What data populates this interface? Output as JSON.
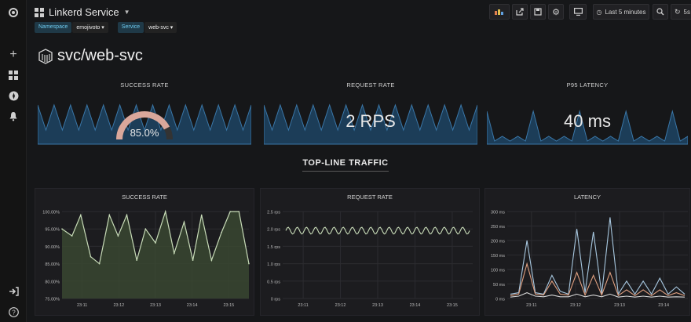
{
  "header": {
    "title": "Linkerd Service",
    "time_range": "Last 5 minutes",
    "refresh": "5s"
  },
  "variables": [
    {
      "label": "Namespace",
      "value": "emojivoto"
    },
    {
      "label": "Service",
      "value": "web-svc"
    }
  ],
  "service_title": "svc/web-svc",
  "singlestats": [
    {
      "title": "SUCCESS RATE",
      "value": "85.0%",
      "gauge_fraction": 0.85
    },
    {
      "title": "REQUEST RATE",
      "value": "2 RPS"
    },
    {
      "title": "P95 LATENCY",
      "value": "40 ms"
    }
  ],
  "row_title": "TOP-LINE TRAFFIC",
  "colors": {
    "accent_blue": "#1f4b6e",
    "spark_line": "#3a77a8",
    "gauge": "#d9a79b",
    "line_green": "#c8dcb8",
    "fill_green": "#3b4a32"
  },
  "chart_data": [
    {
      "type": "line",
      "title": "SUCCESS RATE",
      "x_ticks": [
        "23:11",
        "23:12",
        "23:13",
        "23:14",
        "23:15"
      ],
      "y_ticks": [
        "75.00%",
        "80.00%",
        "85.00%",
        "90.00%",
        "95.00%",
        "100.00%"
      ],
      "ylim": [
        75,
        100
      ],
      "xlim": [
        23.1,
        23.25
      ],
      "x": [
        23.1,
        23.108,
        23.115,
        23.123,
        23.13,
        23.138,
        23.145,
        23.152,
        23.16,
        23.167,
        23.175,
        23.183,
        23.19,
        23.198,
        23.205,
        23.212,
        23.22,
        23.228,
        23.235,
        23.242,
        23.25
      ],
      "y": [
        95,
        93,
        99,
        87,
        85,
        99,
        93,
        99,
        86,
        95,
        91,
        100,
        88,
        97,
        86,
        99,
        86,
        94,
        100,
        100,
        85
      ],
      "fill": true
    },
    {
      "type": "line",
      "title": "REQUEST RATE",
      "x_ticks": [
        "23:11",
        "23:12",
        "23:13",
        "23:14",
        "23:15"
      ],
      "y_ticks": [
        "0 rps",
        "0.5 rps",
        "1.0 rps",
        "1.5 rps",
        "2.0 rps",
        "2.5 rps"
      ],
      "ylim": [
        0,
        2.5
      ],
      "value_range": [
        1.85,
        2.05
      ]
    },
    {
      "type": "line",
      "title": "LATENCY",
      "x_ticks": [
        "23:11",
        "23:12",
        "23:13",
        "23:14"
      ],
      "y_ticks": [
        "0 ms",
        "50 ms",
        "100 ms",
        "150 ms",
        "200 ms",
        "250 ms",
        "300 ms"
      ],
      "ylim": [
        0,
        300
      ],
      "series": [
        {
          "values": [
            15,
            20,
            200,
            20,
            15,
            80,
            25,
            15,
            240,
            20,
            230,
            15,
            280,
            15,
            60,
            15,
            60,
            15,
            70,
            15,
            40,
            15
          ],
          "color": "#a8c8e0"
        },
        {
          "values": [
            10,
            15,
            120,
            15,
            12,
            60,
            15,
            12,
            90,
            12,
            80,
            12,
            90,
            10,
            30,
            10,
            30,
            10,
            30,
            10,
            20,
            10
          ],
          "color": "#e0a080"
        },
        {
          "values": [
            5,
            8,
            20,
            8,
            6,
            12,
            6,
            6,
            15,
            6,
            12,
            6,
            15,
            5,
            8,
            5,
            8,
            5,
            8,
            5,
            6,
            5
          ],
          "color": "#d8d8d8"
        }
      ]
    }
  ]
}
